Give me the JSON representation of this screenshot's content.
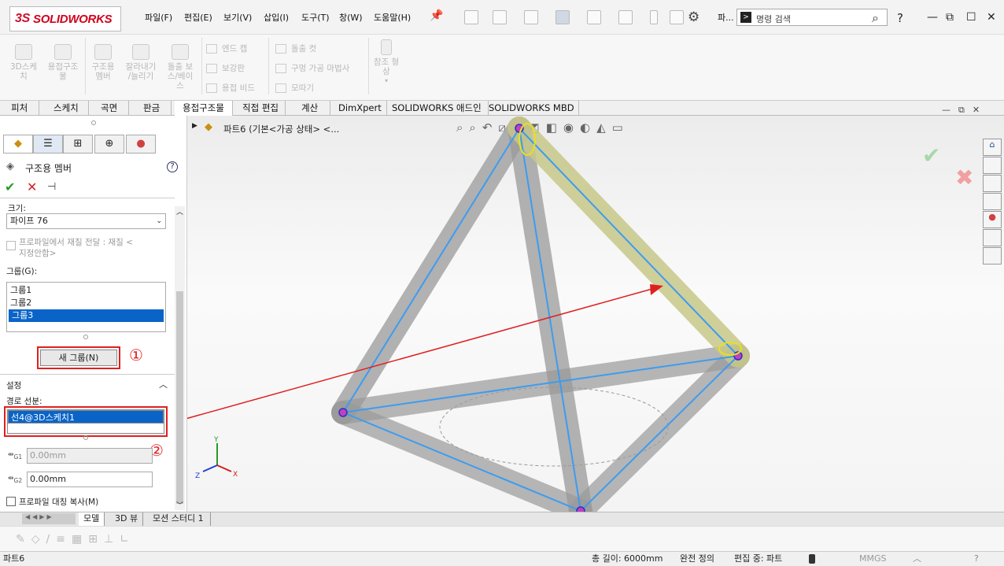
{
  "app": {
    "logo": "SOLIDWORKS"
  },
  "menubar": [
    "파일(F)",
    "편집(E)",
    "보기(V)",
    "삽입(I)",
    "도구(T)",
    "창(W)",
    "도움말(H)"
  ],
  "search": {
    "placeholder": "명령 검색",
    "extra": "파..."
  },
  "toolbar": {
    "big": [
      {
        "label": "3D스케\n치"
      },
      {
        "label": "용접구조\n물"
      },
      {
        "label": "구조용\n멤버"
      },
      {
        "label": "잘라내기\n/늘리기"
      },
      {
        "label": "돌출 보\n스/베이\n스"
      }
    ],
    "col1": [
      "엔드 캡",
      "보강판",
      "용접 비드"
    ],
    "col2": [
      "돌출 컷",
      "구멍 가공 마법사",
      "모따기"
    ],
    "ref": "참조 형\n상"
  },
  "tabs": [
    "피처",
    "스케치",
    "곡면",
    "판금",
    "용접구조물",
    "직접 편집",
    "계산",
    "DimXpert",
    "SOLIDWORKS 애드인",
    "SOLIDWORKS MBD"
  ],
  "active_tab": "용접구조물",
  "panel": {
    "title": "구조용 멤버",
    "size_label": "크기:",
    "size_value": "파이프 76",
    "transfer_label": "프로파일에서 재질 전달 : 재질 <\n지정안함>",
    "group_label": "그룹(G):",
    "groups": [
      "그룹1",
      "그룹2",
      "그룹3"
    ],
    "selected_group": "그룹3",
    "new_group_button": "새 그룹(N)",
    "marker1": "①",
    "settings_label": "설정",
    "path_label": "경로 선분:",
    "path_value": "선4@3D스케치1",
    "marker2": "②",
    "g1_value": "0.00mm",
    "g2_value": "0.00mm",
    "g1_label": "G1",
    "g2_label": "G2",
    "mirror_label": "프로파일 대칭 복사(M)"
  },
  "tree": {
    "label": "파트6  (기본<가공 상태> <..."
  },
  "bottom_tabs": [
    "모델",
    "3D 뷰",
    "모션 스터디 1"
  ],
  "status": {
    "part": "파트6",
    "length": "총 길이: 6000mm",
    "defined": "완전 정의",
    "editing": "편집 중: 파트",
    "units": "MMGS"
  },
  "axes": {
    "x": "X",
    "y": "Y",
    "z": "Z"
  },
  "colors": {
    "accent": "#0a64c8",
    "highlight": "#e02020",
    "member": "#8a8a8a",
    "selected_member": "#c8c88a",
    "sketch": "#3c9cf0"
  }
}
